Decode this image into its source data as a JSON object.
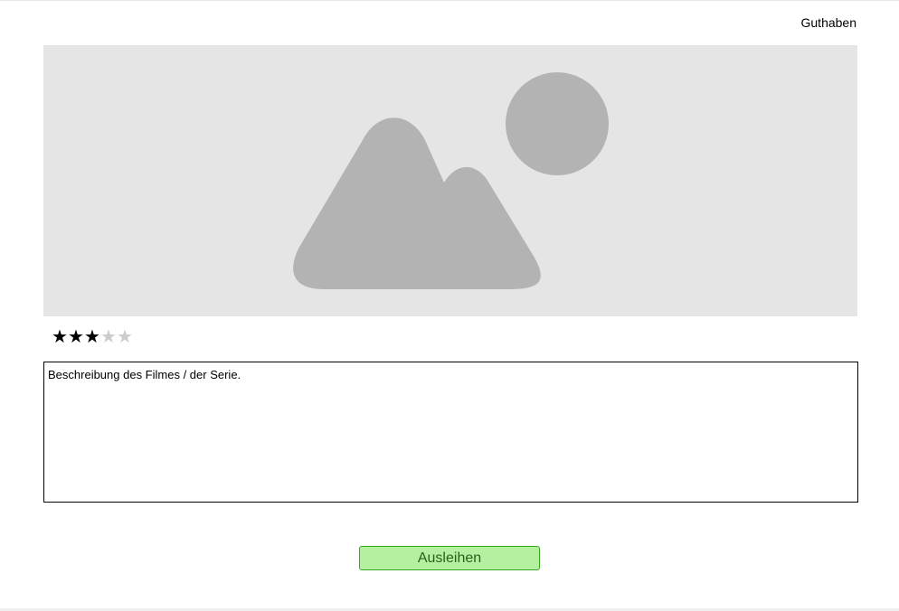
{
  "header": {
    "credit_link": "Guthaben"
  },
  "media": {
    "image_icon": "image-placeholder-icon"
  },
  "rating": {
    "value": 3,
    "max": 5
  },
  "description": {
    "text": "Beschreibung des Filmes / der Serie."
  },
  "actions": {
    "rent_label": "Ausleihen"
  },
  "colors": {
    "placeholder_bg": "#e5e5e5",
    "placeholder_shape": "#b3b3b3",
    "button_bg": "#b3f0a0",
    "button_border": "#3aa51f",
    "button_text": "#2c5f1c",
    "star_filled": "#000000",
    "star_empty": "#cccccc"
  }
}
